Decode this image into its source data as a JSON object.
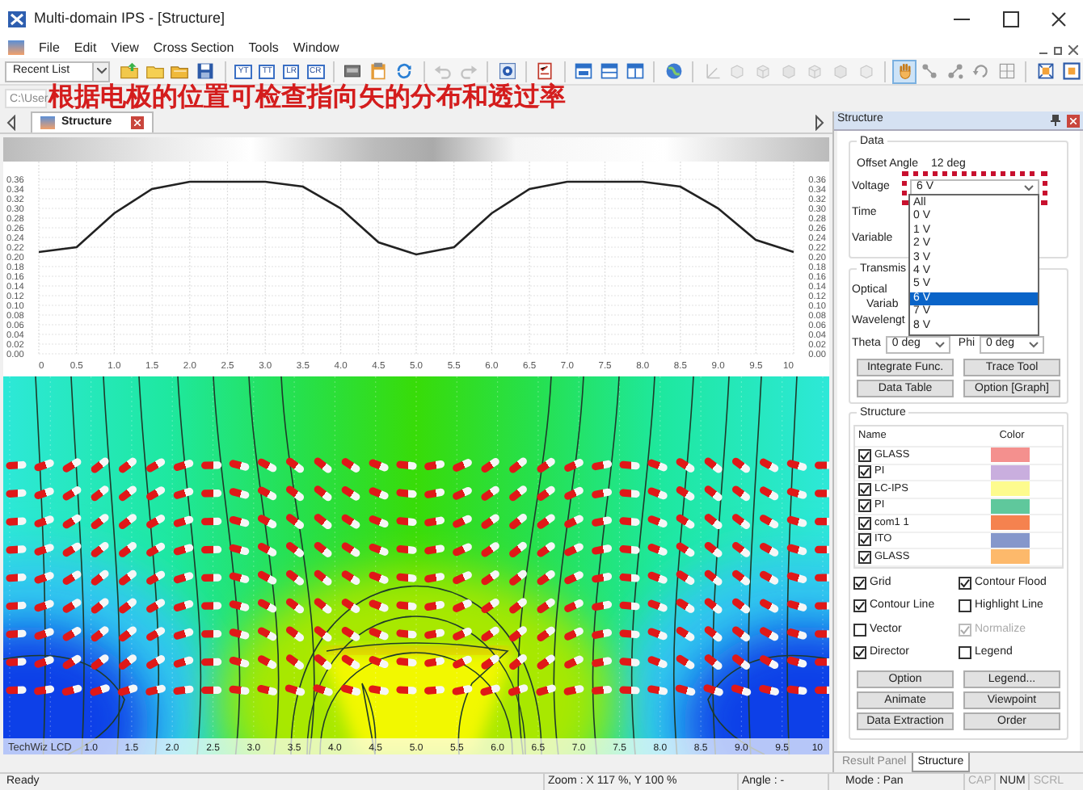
{
  "window": {
    "title": "Multi-domain IPS - [Structure]"
  },
  "menu": [
    "File",
    "Edit",
    "View",
    "Cross Section",
    "Tools",
    "Window"
  ],
  "toolbar": {
    "recent_list": "Recent List",
    "items": [
      {
        "kind": "icon",
        "disabled": false,
        "selected": false
      },
      {
        "kind": "icon",
        "disabled": false,
        "selected": false
      },
      {
        "kind": "icon",
        "disabled": false,
        "selected": false
      },
      {
        "kind": "icon",
        "disabled": false,
        "selected": false
      },
      {
        "kind": "separator"
      },
      {
        "kind": "label",
        "label": "YT"
      },
      {
        "kind": "label",
        "label": "TT"
      },
      {
        "kind": "label",
        "label": "LR"
      },
      {
        "kind": "label",
        "label": "CR"
      },
      {
        "kind": "separator"
      },
      {
        "kind": "icon",
        "disabled": false,
        "selected": false
      },
      {
        "kind": "icon",
        "disabled": false,
        "selected": false
      },
      {
        "kind": "icon",
        "disabled": false,
        "selected": false
      },
      {
        "kind": "separator"
      },
      {
        "kind": "icon",
        "disabled": true,
        "selected": false
      },
      {
        "kind": "icon",
        "disabled": true,
        "selected": false
      },
      {
        "kind": "separator"
      },
      {
        "kind": "icon",
        "disabled": false,
        "selected": false
      },
      {
        "kind": "separator"
      },
      {
        "kind": "icon",
        "disabled": false,
        "selected": false
      },
      {
        "kind": "separator"
      },
      {
        "kind": "icon",
        "disabled": false,
        "selected": false
      },
      {
        "kind": "icon",
        "disabled": false,
        "selected": false
      },
      {
        "kind": "icon",
        "disabled": false,
        "selected": false
      },
      {
        "kind": "separator"
      },
      {
        "kind": "icon",
        "disabled": false,
        "selected": false
      },
      {
        "kind": "separator"
      },
      {
        "kind": "icon",
        "disabled": true,
        "selected": false
      },
      {
        "kind": "icon",
        "disabled": true,
        "selected": false
      },
      {
        "kind": "icon",
        "disabled": true,
        "selected": false
      },
      {
        "kind": "icon",
        "disabled": true,
        "selected": false
      },
      {
        "kind": "icon",
        "disabled": true,
        "selected": false
      },
      {
        "kind": "icon",
        "disabled": true,
        "selected": false
      },
      {
        "kind": "icon",
        "disabled": true,
        "selected": false
      },
      {
        "kind": "separator"
      },
      {
        "kind": "icon",
        "disabled": false,
        "selected": true
      },
      {
        "kind": "icon",
        "disabled": false,
        "selected": false
      },
      {
        "kind": "icon",
        "disabled": false,
        "selected": false
      },
      {
        "kind": "icon",
        "disabled": false,
        "selected": false
      },
      {
        "kind": "icon",
        "disabled": false,
        "selected": false
      },
      {
        "kind": "separator"
      },
      {
        "kind": "icon",
        "disabled": false,
        "selected": false
      },
      {
        "kind": "icon",
        "disabled": false,
        "selected": false
      }
    ]
  },
  "path": "C:\\User",
  "annotation": "根据电极的位置可检查指向矢的分布和透过率",
  "document_tabs": [
    {
      "label": "Structure",
      "selected": true
    }
  ],
  "transmittance_plot": {
    "chart_data": {
      "type": "line",
      "x": [
        0,
        0.5,
        1,
        1.5,
        2,
        2.5,
        3,
        3.5,
        4,
        4.5,
        5,
        5.5,
        6,
        6.5,
        7,
        7.5,
        8,
        8.5,
        9,
        9.5,
        10
      ],
      "grid": true,
      "series": [
        {
          "color": "#222222",
          "values": [
            0.21,
            0.22,
            0.29,
            0.34,
            0.355,
            0.355,
            0.355,
            0.345,
            0.3,
            0.23,
            0.205,
            0.22,
            0.29,
            0.34,
            0.355,
            0.355,
            0.355,
            0.345,
            0.3,
            0.235,
            0.21
          ]
        }
      ],
      "xlim": [
        0,
        10
      ],
      "ylim": [
        0,
        0.36
      ],
      "xticks": [
        {
          "value": 0,
          "label": "0"
        },
        {
          "value": 0.5,
          "label": "0.5"
        },
        {
          "value": 1,
          "label": "1.0"
        },
        {
          "value": 1.5,
          "label": "1.5"
        },
        {
          "value": 2,
          "label": "2.0"
        },
        {
          "value": 2.5,
          "label": "2.5"
        },
        {
          "value": 3,
          "label": "3.0"
        },
        {
          "value": 3.5,
          "label": "3.5"
        },
        {
          "value": 4,
          "label": "4.0"
        },
        {
          "value": 4.5,
          "label": "4.5"
        },
        {
          "value": 5,
          "label": "5.0"
        },
        {
          "value": 5.5,
          "label": "5.5"
        },
        {
          "value": 6,
          "label": "6.0"
        },
        {
          "value": 6.5,
          "label": "6.5"
        },
        {
          "value": 7,
          "label": "7.0"
        },
        {
          "value": 7.5,
          "label": "7.5"
        },
        {
          "value": 8,
          "label": "8.0"
        },
        {
          "value": 8.5,
          "label": "8.5"
        },
        {
          "value": 9,
          "label": "9.0"
        },
        {
          "value": 9.5,
          "label": "9.5"
        },
        {
          "value": 10,
          "label": "10"
        }
      ],
      "yticks": [
        {
          "value": 0,
          "label": "0.00"
        },
        {
          "value": 0.02,
          "label": "0.02"
        },
        {
          "value": 0.04,
          "label": "0.04"
        },
        {
          "value": 0.06,
          "label": "0.06"
        },
        {
          "value": 0.08,
          "label": "0.08"
        },
        {
          "value": 0.1,
          "label": "0.10"
        },
        {
          "value": 0.12,
          "label": "0.12"
        },
        {
          "value": 0.14,
          "label": "0.14"
        },
        {
          "value": 0.16,
          "label": "0.16"
        },
        {
          "value": 0.18,
          "label": "0.18"
        },
        {
          "value": 0.2,
          "label": "0.20"
        },
        {
          "value": 0.22,
          "label": "0.22"
        },
        {
          "value": 0.24,
          "label": "0.24"
        },
        {
          "value": 0.26,
          "label": "0.26"
        },
        {
          "value": 0.28,
          "label": "0.28"
        },
        {
          "value": 0.3,
          "label": "0.30"
        },
        {
          "value": 0.32,
          "label": "0.32"
        },
        {
          "value": 0.34,
          "label": "0.34"
        },
        {
          "value": 0.36,
          "label": "0.36"
        }
      ]
    }
  },
  "contour_plot": {
    "caption": "TechWiz LCD",
    "x_labels": [
      "1.0",
      "1.5",
      "2.0",
      "2.5",
      "3.0",
      "3.5",
      "4.0",
      "4.5",
      "5.0",
      "5.5",
      "6.0",
      "6.5",
      "7.0",
      "7.5",
      "8.0",
      "8.5",
      "9.0",
      "9.5",
      "10"
    ]
  },
  "side_panel": {
    "title": "Structure",
    "data_group": {
      "title": "Data",
      "offset_angle": {
        "label": "Offset Angle",
        "value": "12 deg"
      },
      "voltage": {
        "label": "Voltage",
        "value": "6 V",
        "expanded": true,
        "highlighted": true,
        "options": [
          {
            "label": "All",
            "selected": false
          },
          {
            "label": "0 V",
            "selected": false
          },
          {
            "label": "1 V",
            "selected": false
          },
          {
            "label": "2 V",
            "selected": false
          },
          {
            "label": "3 V",
            "selected": false
          },
          {
            "label": "4 V",
            "selected": false
          },
          {
            "label": "5 V",
            "selected": false
          },
          {
            "label": "6 V",
            "selected": true
          },
          {
            "label": "7 V",
            "selected": false
          },
          {
            "label": "8 V",
            "selected": false
          }
        ]
      },
      "time_label": "Time",
      "variable_label": "Variable"
    },
    "transmission_group": {
      "title": "Transmis",
      "optical_label": "Optical",
      "variable_label": "Variab",
      "wavelength_label": "Wavelengt",
      "theta": {
        "label": "Theta",
        "value": "0 deg"
      },
      "phi": {
        "label": "Phi",
        "value": "0 deg"
      },
      "buttons": [
        "Integrate Func.",
        "Trace Tool",
        "Data Table",
        "Option [Graph]"
      ]
    },
    "structure_group": {
      "title": "Structure",
      "columns": [
        "Name",
        "Color"
      ],
      "layers": [
        {
          "name": "GLASS",
          "checked": true,
          "color": "#f4908e"
        },
        {
          "name": "PI",
          "checked": true,
          "color": "#c9aede"
        },
        {
          "name": "LC-IPS",
          "checked": true,
          "color": "#fdfb8e"
        },
        {
          "name": "PI",
          "checked": true,
          "color": "#5fc89c"
        },
        {
          "name": "com1 1",
          "checked": true,
          "color": "#f5824f"
        },
        {
          "name": "ITO",
          "checked": true,
          "color": "#8597cb"
        },
        {
          "name": "GLASS",
          "checked": true,
          "color": "#fdb96b"
        }
      ],
      "options": [
        {
          "label": "Grid",
          "checked": true,
          "disabled": false
        },
        {
          "label": "Contour Flood",
          "checked": true,
          "disabled": false
        },
        {
          "label": "Contour Line",
          "checked": true,
          "disabled": false
        },
        {
          "label": "Highlight Line",
          "checked": false,
          "disabled": false
        },
        {
          "label": "Vector",
          "checked": false,
          "disabled": false
        },
        {
          "label": "Normalize",
          "checked": true,
          "disabled": true
        },
        {
          "label": "Director",
          "checked": true,
          "disabled": false
        },
        {
          "label": "Legend",
          "checked": false,
          "disabled": false
        }
      ],
      "buttons": [
        "Option",
        "Legend...",
        "Animate",
        "Viewpoint",
        "Data Extraction",
        "Order"
      ]
    },
    "bottom_tabs": [
      {
        "label": "Result Panel",
        "selected": false
      },
      {
        "label": "Structure",
        "selected": true
      }
    ]
  },
  "status_bar": {
    "message": "Ready",
    "zoom": "Zoom : X 117 %, Y 100 %",
    "angle": "Angle : -",
    "mode": "Mode : Pan",
    "indicators": [
      {
        "label": "CAP",
        "on": false
      },
      {
        "label": "NUM",
        "on": true
      },
      {
        "label": "SCRL",
        "on": false
      }
    ]
  }
}
